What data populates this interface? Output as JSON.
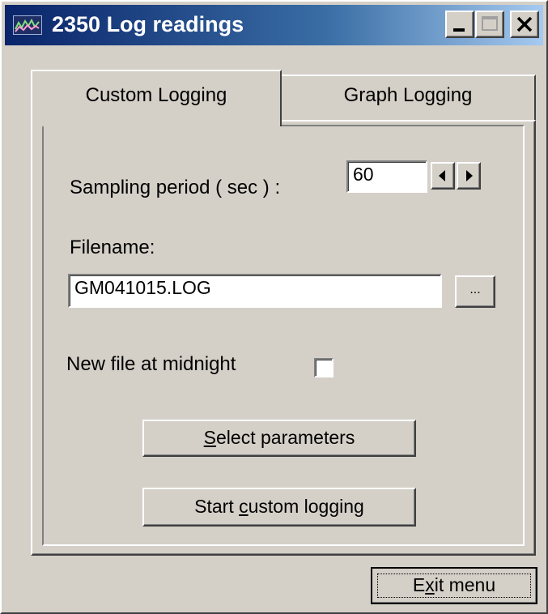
{
  "window": {
    "title": "2350 Log readings",
    "icon": "app-graph-icon",
    "controls": [
      "minimize-icon",
      "maximize-icon",
      "close-icon"
    ]
  },
  "tabs": [
    {
      "label": "Custom Logging",
      "active": true
    },
    {
      "label": "Graph Logging",
      "active": false
    }
  ],
  "custom_logging": {
    "sampling_label": "Sampling period ( sec ) :",
    "sampling_value": "60",
    "filename_label": "Filename:",
    "filename_value": "GM041015.LOG",
    "browse_label": "...",
    "midnight_label": "New file at midnight",
    "midnight_checked": false,
    "select_params": {
      "mnemonic": "S",
      "rest": "elect parameters"
    },
    "start_logging": {
      "pre": "Start ",
      "mnemonic": "c",
      "rest": "ustom logging"
    }
  },
  "footer": {
    "exit": {
      "pre": "E",
      "mnemonic": "x",
      "rest": "it menu"
    }
  },
  "colors": {
    "face": "#d4d0c8",
    "titlebar_start": "#0a246a",
    "titlebar_end": "#a6caf0"
  }
}
